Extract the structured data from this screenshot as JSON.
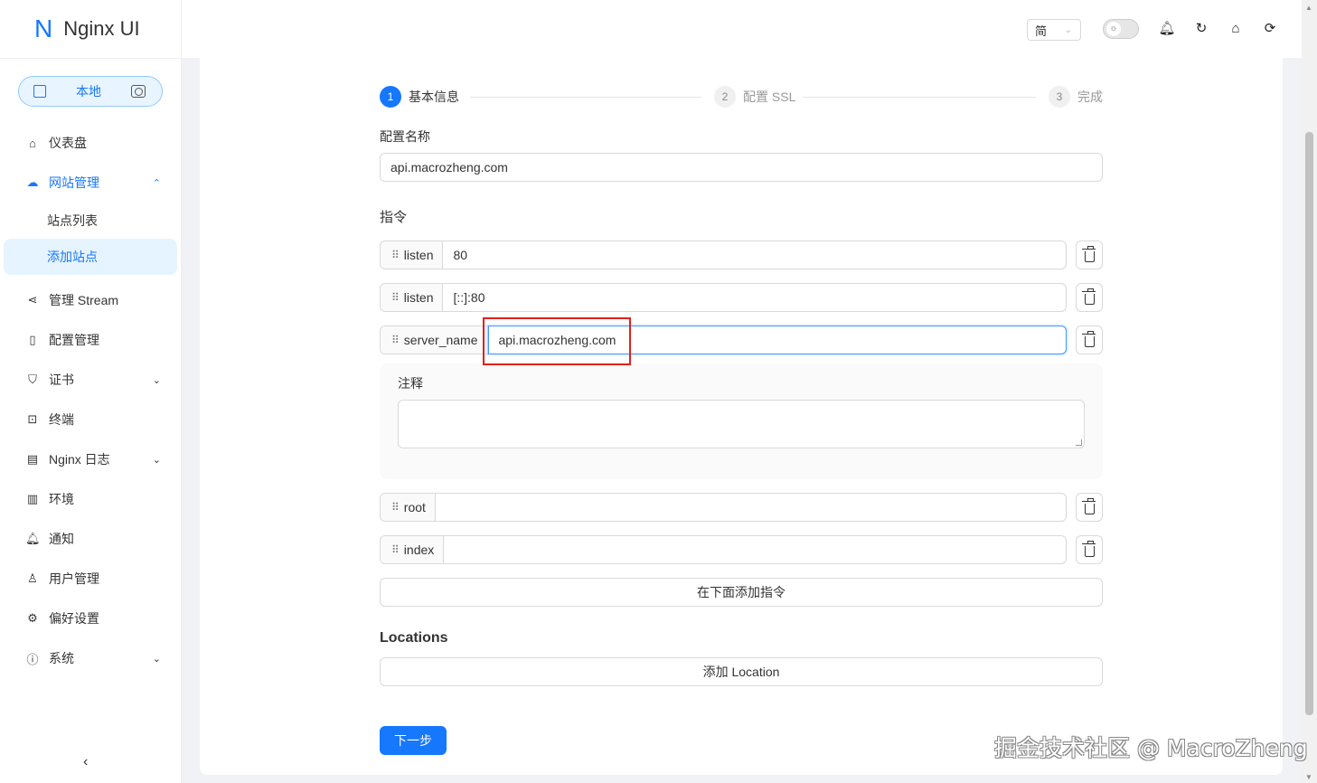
{
  "app": {
    "logo_letter": "N",
    "title": "Nginx UI"
  },
  "env_switch": {
    "label": "本地"
  },
  "sidebar": {
    "items": [
      {
        "label": "仪表盘",
        "icon": "home-icon"
      },
      {
        "label": "网站管理",
        "icon": "cloud-icon",
        "expanded": true
      },
      {
        "label": "管理 Stream",
        "icon": "share-icon"
      },
      {
        "label": "配置管理",
        "icon": "file-icon"
      },
      {
        "label": "证书",
        "icon": "shield-icon"
      },
      {
        "label": "终端",
        "icon": "terminal-icon"
      },
      {
        "label": "Nginx 日志",
        "icon": "file-text-icon"
      },
      {
        "label": "环境",
        "icon": "database-icon"
      },
      {
        "label": "通知",
        "icon": "bell-icon"
      },
      {
        "label": "用户管理",
        "icon": "user-icon"
      },
      {
        "label": "偏好设置",
        "icon": "gear-icon"
      },
      {
        "label": "系统",
        "icon": "info-icon"
      }
    ],
    "subitems": [
      {
        "label": "站点列表"
      },
      {
        "label": "添加站点",
        "active": true
      }
    ]
  },
  "header": {
    "language": "简"
  },
  "steps": [
    {
      "num": "1",
      "title": "基本信息",
      "status": "active"
    },
    {
      "num": "2",
      "title": "配置 SSL",
      "status": "wait"
    },
    {
      "num": "3",
      "title": "完成",
      "status": "wait"
    }
  ],
  "form": {
    "config_name_label": "配置名称",
    "config_name_value": "api.macrozheng.com",
    "directives_label": "指令",
    "directives": [
      {
        "name": "listen",
        "value": "80"
      },
      {
        "name": "listen",
        "value": "[::]:80"
      },
      {
        "name": "server_name",
        "value": "api.macrozheng.com"
      },
      {
        "name": "root",
        "value": ""
      },
      {
        "name": "index",
        "value": ""
      }
    ],
    "comment_label": "注释",
    "add_directive_label": "在下面添加指令",
    "locations_label": "Locations",
    "add_location_label": "添加 Location",
    "next_label": "下一步"
  },
  "watermark": "掘金技术社区 @ MacroZheng",
  "colors": {
    "primary": "#1677ff",
    "highlight": "#e0201b"
  }
}
